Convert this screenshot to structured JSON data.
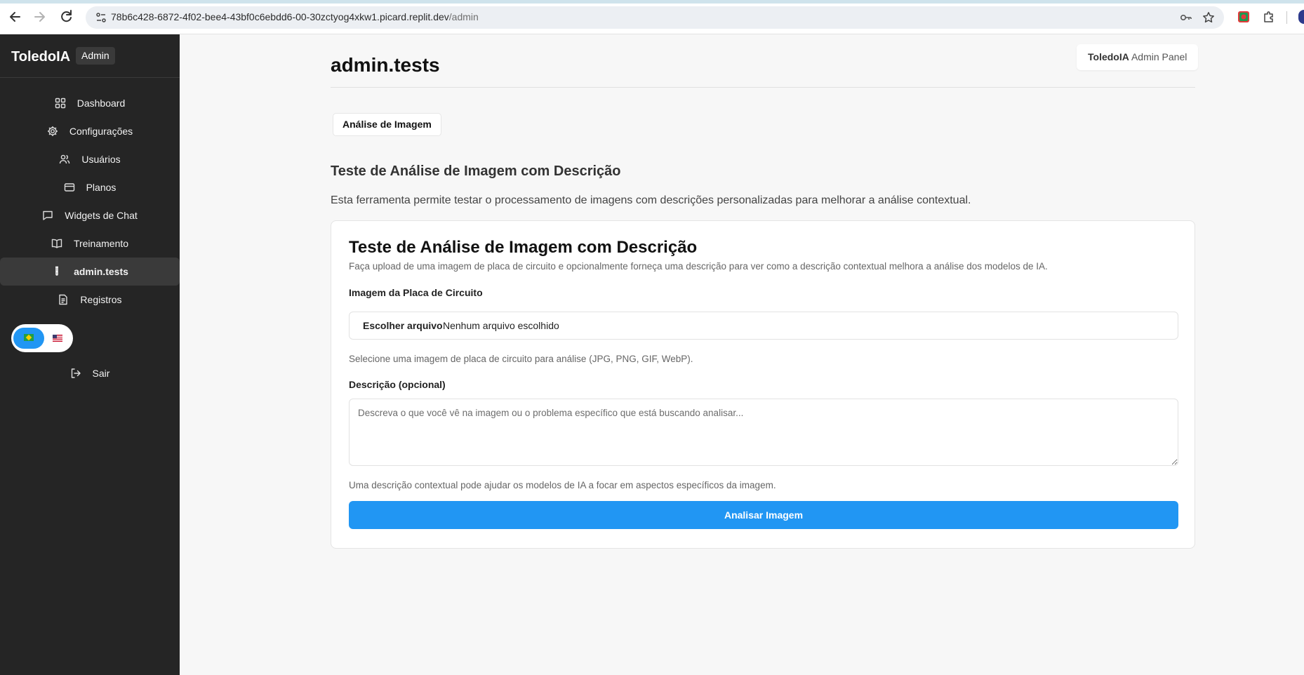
{
  "browser": {
    "url_host": "78b6c428-6872-4f02-bee4-43bf0c6ebdd6-00-30zctyog4xkw1.picard.replit.dev",
    "url_path": "/admin",
    "icons": [
      "back-arrow-icon",
      "forward-arrow-icon",
      "reload-icon",
      "site-info-icon",
      "password-key-icon",
      "bookmark-star-icon",
      "extension-icon",
      "extensions-puzzle-icon"
    ]
  },
  "sidebar": {
    "brand": "ToledoIA",
    "brand_badge": "Admin",
    "items": [
      {
        "label": "Dashboard",
        "icon": "grid-icon"
      },
      {
        "label": "Configurações",
        "icon": "gear-icon"
      },
      {
        "label": "Usuários",
        "icon": "users-icon"
      },
      {
        "label": "Planos",
        "icon": "credit-card-icon"
      },
      {
        "label": "Widgets de Chat",
        "icon": "chat-bubble-icon"
      },
      {
        "label": "Treinamento",
        "icon": "book-icon"
      },
      {
        "label": "admin.tests",
        "icon": "test-tube-icon",
        "active": true
      },
      {
        "label": "Registros",
        "icon": "file-text-icon"
      }
    ],
    "language_toggle": {
      "selected": "pt-BR",
      "options": [
        "pt-BR",
        "en-US"
      ]
    },
    "logout_label": "Sair"
  },
  "header": {
    "title": "admin.tests",
    "panel_badge_brand": "ToledoIA",
    "panel_badge_text": "Admin Panel"
  },
  "tabs": [
    {
      "label": "Análise de Imagem"
    }
  ],
  "section": {
    "title": "Teste de Análise de Imagem com Descrição",
    "description": "Esta ferramenta permite testar o processamento de imagens com descrições personalizadas para melhorar a análise contextual."
  },
  "card": {
    "title": "Teste de Análise de Imagem com Descrição",
    "subtitle": "Faça upload de uma imagem de placa de circuito e opcionalmente forneça uma descrição para ver como a descrição contextual melhora a análise dos modelos de IA.",
    "image_label": "Imagem da Placa de Circuito",
    "file_button": "Escolher arquivo",
    "file_status": "Nenhum arquivo escolhido",
    "image_hint": "Selecione uma imagem de placa de circuito para análise (JPG, PNG, GIF, WebP).",
    "description_label": "Descrição (opcional)",
    "description_placeholder": "Descreva o que você vê na imagem ou o problema específico que está buscando analisar...",
    "description_value": "",
    "description_hint": "Uma descrição contextual pode ajudar os modelos de IA a focar em aspectos específicos da imagem.",
    "submit_label": "Analisar Imagem"
  },
  "colors": {
    "sidebar_bg": "#252525",
    "sidebar_active_bg": "#3a3a3a",
    "accent": "#2196f3",
    "page_bg": "#f7f7f7"
  }
}
